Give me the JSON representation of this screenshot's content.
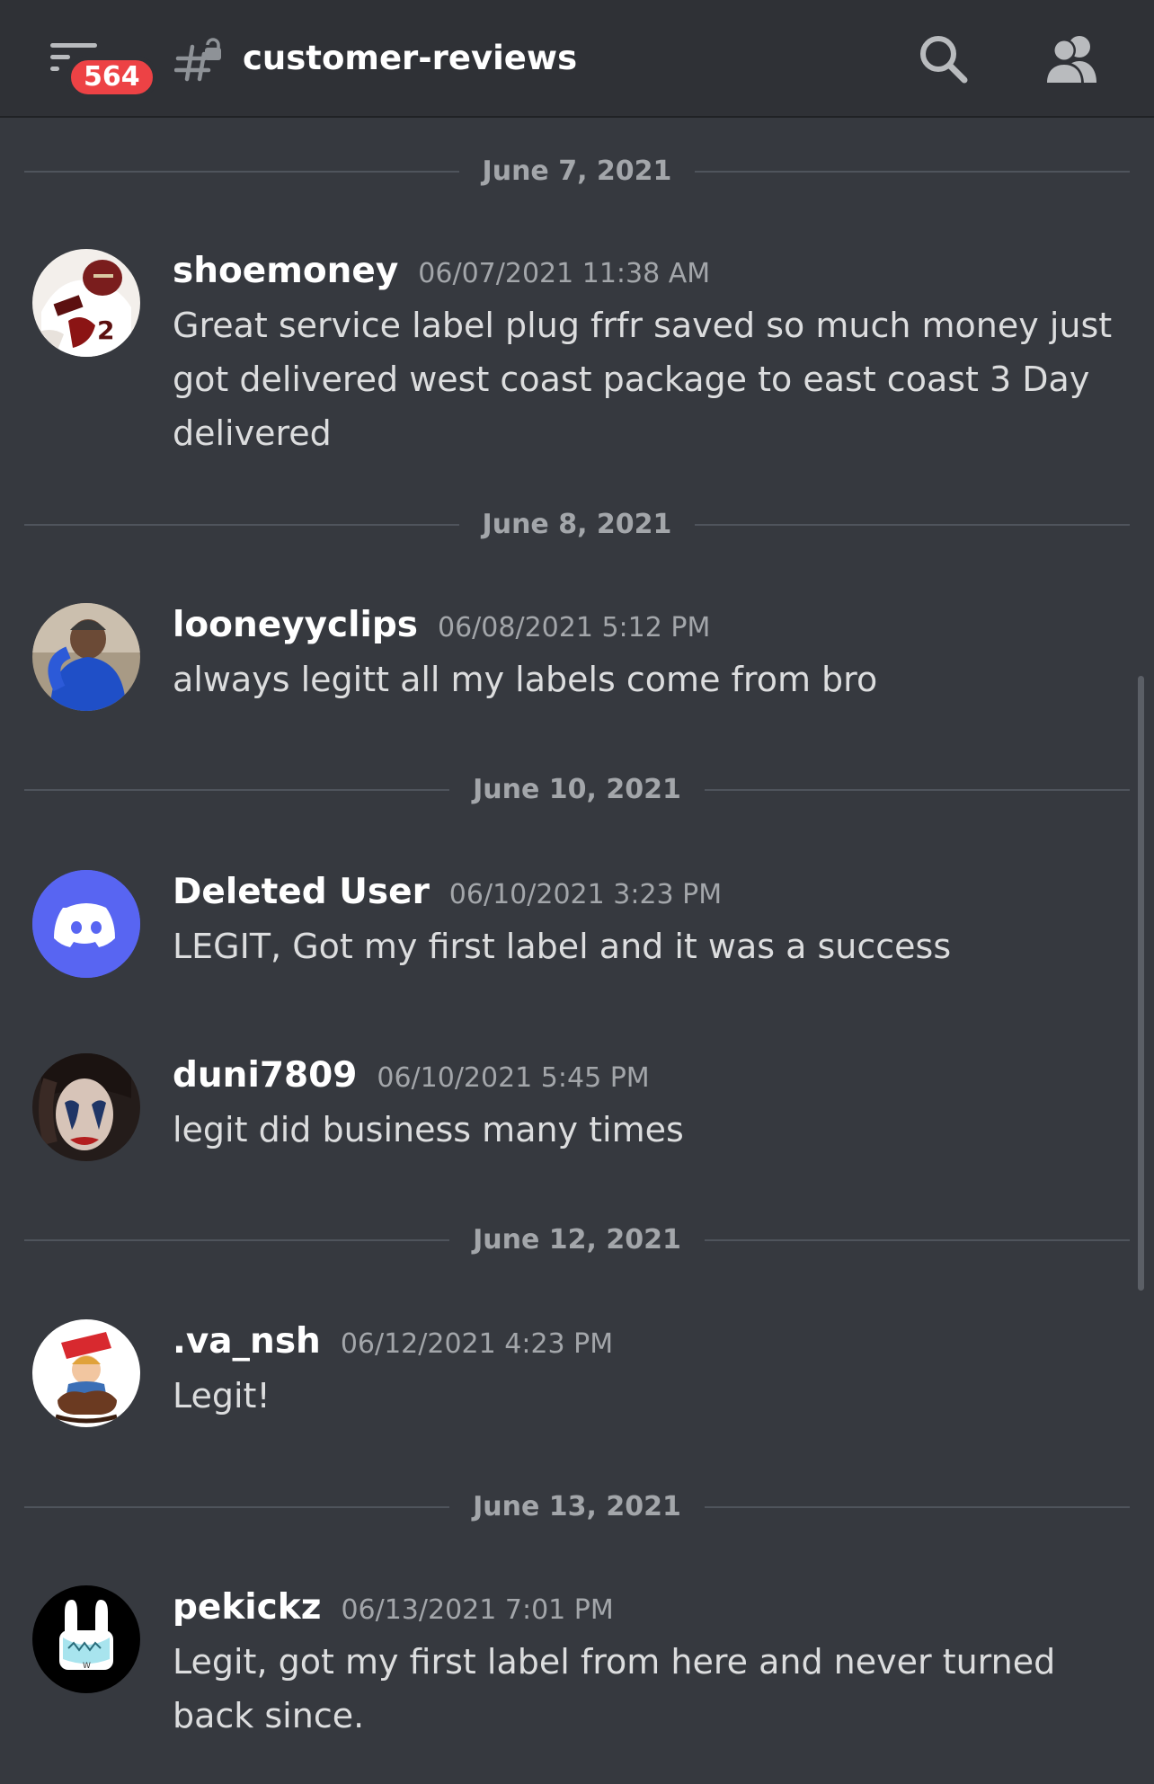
{
  "header": {
    "badge_count": "564",
    "channel_name": "customer-reviews",
    "icons": {
      "menu": "hamburger-menu-icon",
      "channel": "locked-text-channel-icon",
      "search": "search-icon",
      "members": "members-icon"
    }
  },
  "messages": [
    {
      "date": "June 7, 2021",
      "username": "shoemoney",
      "timestamp": "06/07/2021 11:38 AM",
      "text": "Great service label plug frfr saved so much money just got delivered west coast package to east coast 3 Day delivered"
    },
    {
      "date": "June 8, 2021",
      "username": "looneyyclips",
      "timestamp": "06/08/2021 5:12 PM",
      "text": "always legitt all my labels come from bro"
    },
    {
      "date": "June 10, 2021",
      "username": "Deleted User",
      "timestamp": "06/10/2021 3:23 PM",
      "text": "LEGIT, Got my first label and it was a success"
    },
    {
      "username": "duni7809",
      "timestamp": "06/10/2021 5:45 PM",
      "text": "legit did business many times"
    },
    {
      "date": "June 12, 2021",
      "username": ".va_nsh",
      "timestamp": "06/12/2021 4:23 PM",
      "text": "Legit!"
    },
    {
      "date": "June 13, 2021",
      "username": "pekickz",
      "timestamp": "06/13/2021 7:01 PM",
      "text": "Legit, got my first label from here and never turned back since."
    }
  ],
  "colors": {
    "background": "#36393f",
    "header": "#2f3136",
    "badge": "#ed4245",
    "blurple": "#5865f2",
    "muted_text": "#a3a6aa",
    "message_text": "#dcddde"
  }
}
